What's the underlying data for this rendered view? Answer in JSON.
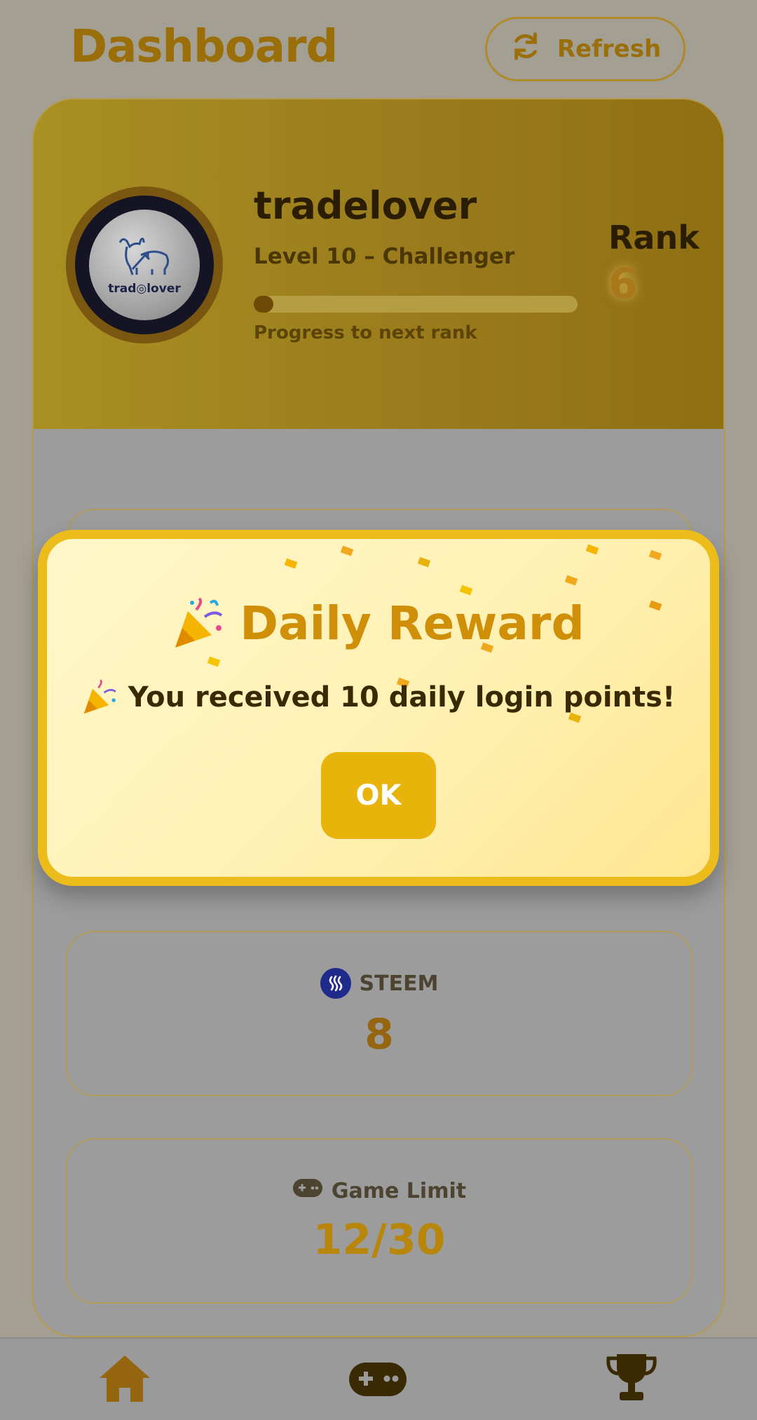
{
  "header": {
    "title": "Dashboard",
    "refresh_label": "Refresh"
  },
  "profile": {
    "username": "tradelover",
    "level_text": "Level 10 – Challenger",
    "progress_caption": "Progress to next rank",
    "progress_fraction": 0.06,
    "rank_label": "Rank",
    "rank_value": "6",
    "avatar_text": "trad◎lover"
  },
  "stats": {
    "steem": {
      "label": "STEEM",
      "value": "8"
    },
    "game_limit": {
      "label": "Game Limit",
      "value": "12/30"
    }
  },
  "modal": {
    "title": "Daily Reward",
    "message": "You received 10 daily login points!",
    "ok_label": "OK"
  },
  "nav": {
    "items": [
      "home-icon",
      "gamepad-icon",
      "trophy-icon"
    ]
  },
  "colors": {
    "accent": "#e8b40c",
    "brand_gold": "#d08f08",
    "banner": "#a89022"
  }
}
